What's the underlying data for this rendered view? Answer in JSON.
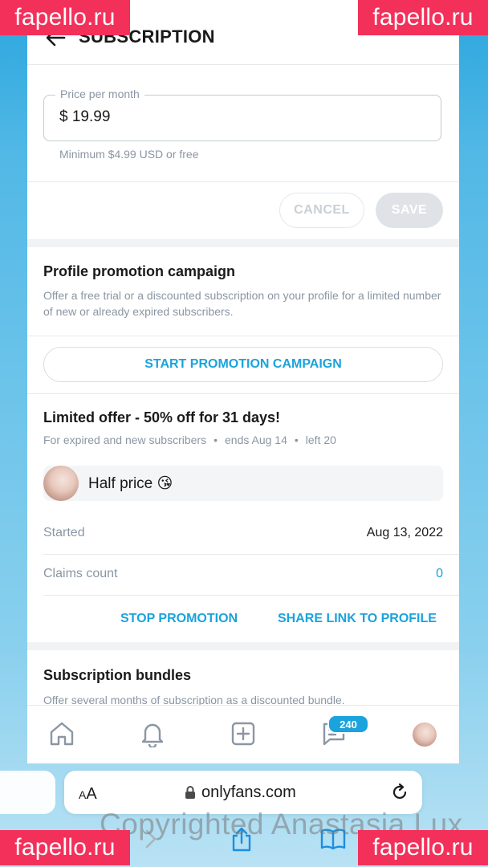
{
  "header": {
    "title": "SUBSCRIPTION"
  },
  "price": {
    "label": "Price per month",
    "value": "$ 19.99",
    "hint": "Minimum $4.99 USD or free"
  },
  "form_actions": {
    "cancel_label": "CANCEL",
    "save_label": "SAVE"
  },
  "promotion": {
    "title": "Profile promotion campaign",
    "description": "Offer a free trial or a discounted subscription on your profile for a limited number of new or already expired subscribers.",
    "start_label": "START PROMOTION CAMPAIGN"
  },
  "offer": {
    "title": "Limited offer - 50% off for 31 days!",
    "audience": "For expired and new subscribers",
    "ends": "ends Aug 14",
    "left": "left 20",
    "separator": "•",
    "name": "Half price 😘",
    "started_label": "Started",
    "started_value": "Aug 13, 2022",
    "claims_label": "Claims count",
    "claims_value": "0",
    "stop_label": "STOP PROMOTION",
    "share_label": "SHARE LINK TO PROFILE"
  },
  "bundles": {
    "title": "Subscription bundles",
    "description": "Offer several months of subscription as a discounted bundle."
  },
  "nav": {
    "messages_badge": "240",
    "icons": [
      "home-icon",
      "bell-icon",
      "add-post-icon",
      "messages-icon",
      "profile-avatar"
    ]
  },
  "browser": {
    "aa_small": "A",
    "aa_large": "A",
    "url": "onlyfans.com"
  },
  "watermarks": {
    "site": "fapello.ru",
    "copyright": "Copyrighted Anastasia Lux"
  },
  "colors": {
    "accent": "#1aa3dc",
    "watermark": "#f2305a",
    "muted_text": "#8a96a3"
  }
}
